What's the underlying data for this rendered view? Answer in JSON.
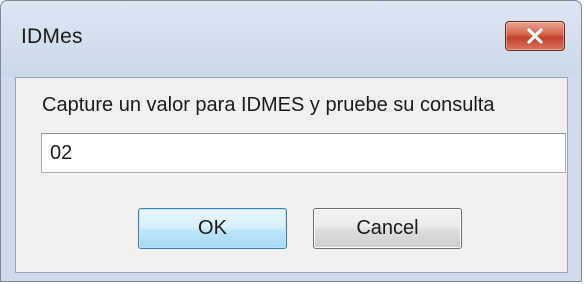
{
  "window": {
    "title": "IDMes"
  },
  "dialog": {
    "prompt": "Capture un valor para IDMES y pruebe su consulta",
    "input_value": "02"
  },
  "buttons": {
    "ok_label": "OK",
    "cancel_label": "Cancel"
  },
  "icons": {
    "close": "close-icon"
  },
  "colors": {
    "title_bar": "#cfdbe9",
    "close_button": "#c84a33",
    "default_button_border": "#3c7fb1"
  }
}
